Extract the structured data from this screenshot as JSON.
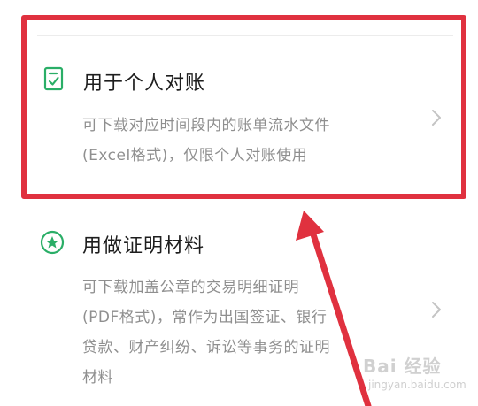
{
  "options": [
    {
      "title": "用于个人对账",
      "description_lines": [
        "可下载对应时间段内的账单流水文件",
        "(Excel格式)，仅限个人对账使用"
      ],
      "icon": "document-check-icon"
    },
    {
      "title": "用做证明材料",
      "description_lines": [
        "可下载加盖公章的交易明细证明",
        "(PDF格式)，常作为出国签证、银行",
        "贷款、财产纠纷、诉讼等事务的证明",
        "材料"
      ],
      "icon": "star-badge-icon"
    }
  ],
  "watermark": {
    "brand": "Bai 经验",
    "url": "jingyan.baidu.com"
  },
  "colors": {
    "accent_green": "#2aae67",
    "annotation_red": "#e0313f",
    "text_primary": "#1e1e1e",
    "text_secondary": "#8f8f8f"
  }
}
